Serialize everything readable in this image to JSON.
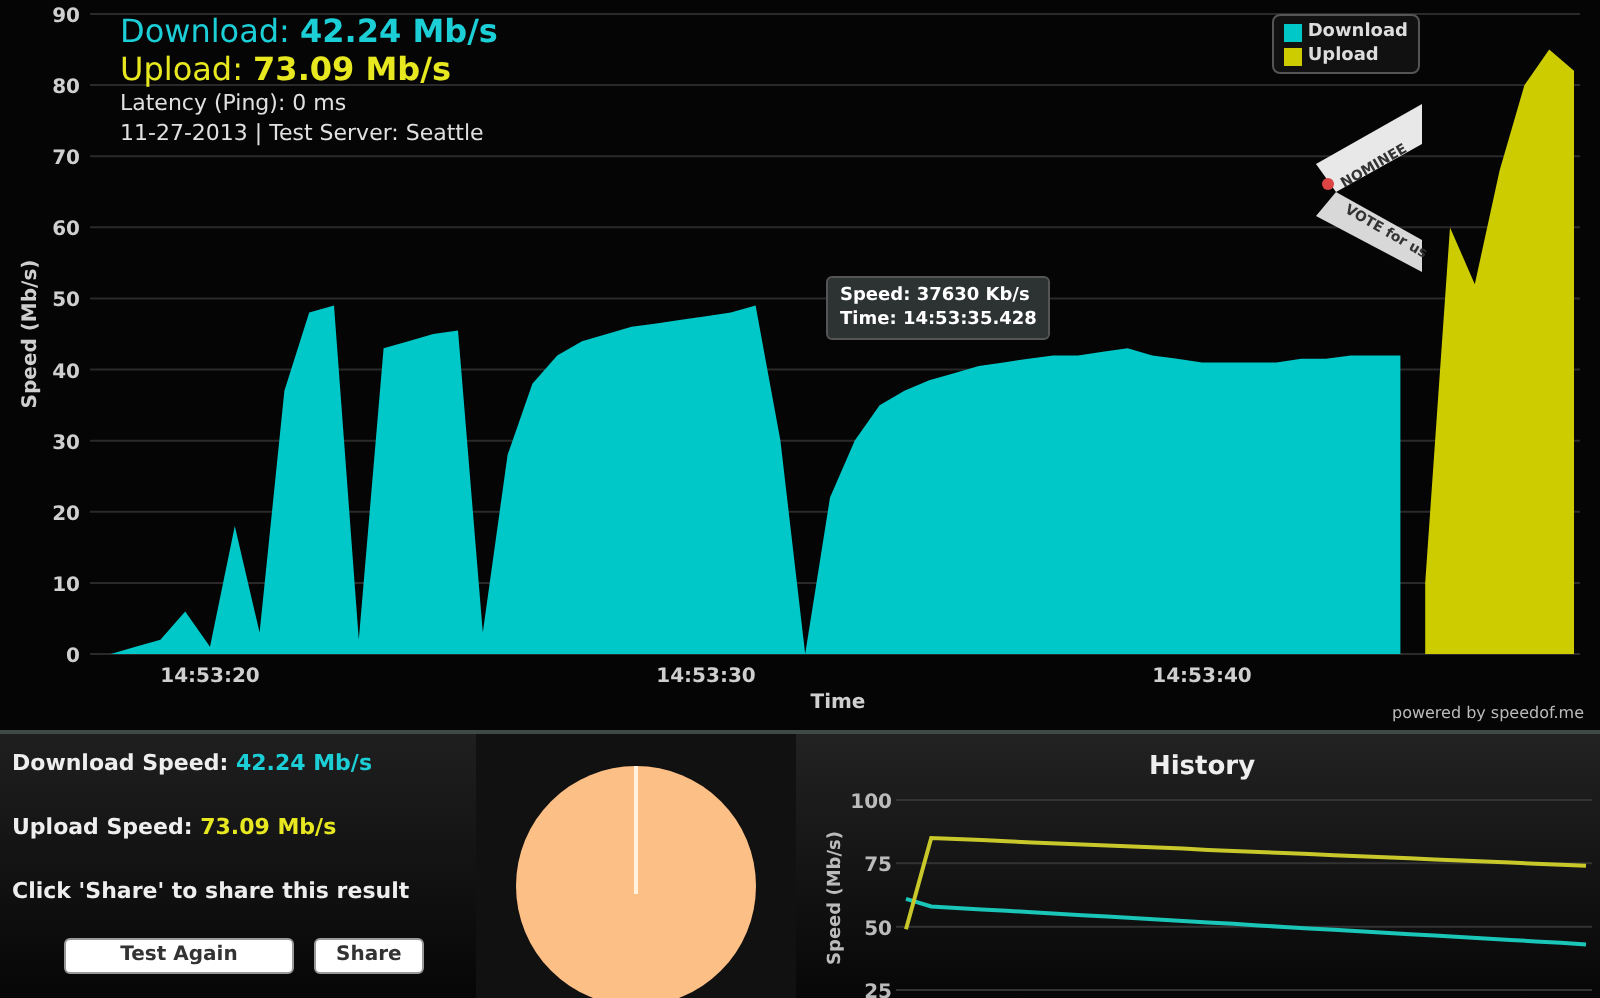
{
  "result_header": {
    "download": "Download: **42.24 Mb/s**",
    "upload": "Upload: **73.09 Mb/s**",
    "latency": "Latency (Ping): 0 ms",
    "date_server": "11-27-2013 | Test Server: Seattle"
  },
  "speed_chart": {
    "chart_data": {
      "type": "area",
      "xlabel": "Time",
      "ylabel": "Speed (Mb/s)",
      "categories": [
        null,
        null,
        null,
        null,
        null,
        "14:53:20",
        null,
        null,
        null,
        null,
        null,
        null,
        null,
        null,
        null,
        null,
        null,
        null,
        null,
        null,
        null,
        null,
        null,
        null,
        null,
        "14:53:30",
        null,
        null,
        null,
        null,
        null,
        null,
        null,
        null,
        null,
        null,
        null,
        null,
        null,
        null,
        null,
        null,
        null,
        null,
        null,
        "14:53:40",
        null,
        null,
        null,
        null,
        null,
        null,
        null,
        null,
        null,
        null,
        null,
        null,
        null,
        null,
        null
      ],
      "series": [
        {
          "name": "Download",
          "color": "#00c8c8",
          "values": [
            0,
            0,
            1,
            2,
            6,
            1,
            18,
            3,
            37,
            48,
            49,
            2,
            43,
            44,
            45,
            45.5,
            3,
            28,
            38,
            42,
            44,
            45,
            46,
            46.5,
            47,
            47.5,
            48,
            49,
            30,
            0,
            22,
            30,
            35,
            37,
            38.5,
            39.5,
            40.5,
            41,
            41.5,
            42,
            42,
            42.5,
            43,
            42,
            41.5,
            41,
            41,
            41,
            41,
            41.5,
            41.5,
            42,
            42,
            42,
            null,
            null,
            null,
            null,
            null,
            null,
            null
          ]
        },
        {
          "name": "Upload",
          "color": "#cccc00",
          "values": [
            null,
            null,
            null,
            null,
            null,
            null,
            null,
            null,
            null,
            null,
            null,
            null,
            null,
            null,
            null,
            null,
            null,
            null,
            null,
            null,
            null,
            null,
            null,
            null,
            null,
            null,
            null,
            null,
            null,
            null,
            null,
            null,
            null,
            null,
            null,
            null,
            null,
            null,
            null,
            null,
            null,
            null,
            null,
            null,
            null,
            null,
            null,
            null,
            null,
            null,
            null,
            null,
            null,
            null,
            10,
            60,
            52,
            68,
            80,
            85,
            82
          ]
        }
      ],
      "ylim": [
        0,
        90
      ],
      "grid": true,
      "yticks": [
        0,
        10,
        20,
        30,
        40,
        50,
        60,
        70,
        80,
        90
      ]
    },
    "tooltip": {
      "speed": "Speed: **37630** Kb/s",
      "time": "Time: 14:53:35.428"
    },
    "ribbon": {
      "top": "NOMINEE",
      "bottom": "VOTE for us"
    },
    "credit": "powered by speedof.me"
  },
  "summary": {
    "download_label": "Download Speed:",
    "download_value": "42.24 Mb/s",
    "upload_label": "Upload Speed:",
    "upload_value": "73.09 Mb/s",
    "note": "Click 'Share' to share this result",
    "buttons": [
      "Test Again",
      "Share"
    ]
  },
  "history": {
    "chart_data": {
      "type": "line",
      "title": "History",
      "ylabel": "Speed (Mb/s)",
      "categories": [
        null,
        null,
        null,
        null,
        null,
        null,
        null,
        null,
        null,
        null,
        null,
        null,
        null,
        null,
        null,
        null,
        null,
        null,
        null,
        null,
        null,
        null,
        null,
        null,
        null,
        null,
        null,
        null
      ],
      "series": [
        {
          "color": "#19c6b8",
          "values": [
            61,
            58,
            57.4,
            56.8,
            56.3,
            55.7,
            55.1,
            54.5,
            54,
            53.4,
            52.8,
            52.2,
            51.7,
            51.1,
            50.5,
            49.9,
            49.3,
            48.8,
            48.2,
            47.6,
            47,
            46.5,
            45.9,
            45.3,
            44.7,
            44.2,
            43.6,
            43
          ]
        },
        {
          "color": "#c8c82a",
          "values": [
            49,
            85,
            84.6,
            84.2,
            83.7,
            83.3,
            82.9,
            82.5,
            82,
            81.6,
            81.2,
            80.8,
            80.3,
            79.9,
            79.5,
            79.1,
            78.7,
            78.2,
            77.8,
            77.4,
            77,
            76.5,
            76.1,
            75.7,
            75.3,
            74.8,
            74.4,
            74
          ]
        }
      ],
      "ylim": [
        25,
        100
      ],
      "yticks": [
        25,
        50,
        75,
        100
      ]
    }
  }
}
